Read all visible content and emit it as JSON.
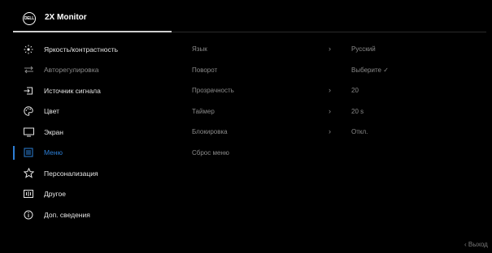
{
  "header": {
    "logo_text": "DELL",
    "title": "2X Monitor"
  },
  "menu": {
    "items": [
      {
        "label": "Яркость/контрастность",
        "icon": "brightness-icon"
      },
      {
        "label": "Авторегулировка",
        "icon": "auto-adjust-icon"
      },
      {
        "label": "Источник сигнала",
        "icon": "input-source-icon"
      },
      {
        "label": "Цвет",
        "icon": "color-palette-icon"
      },
      {
        "label": "Экран",
        "icon": "display-icon"
      },
      {
        "label": "Меню",
        "icon": "menu-icon"
      },
      {
        "label": "Персонализация",
        "icon": "star-icon"
      },
      {
        "label": "Другое",
        "icon": "other-icon"
      },
      {
        "label": "Доп. сведения",
        "icon": "info-icon"
      }
    ],
    "active_index": 5,
    "active_color": "#2d7fd6"
  },
  "submenu": {
    "rows": [
      {
        "name": "Язык",
        "arrow": "›",
        "value": "Русский"
      },
      {
        "name": "Поворот",
        "arrow": "",
        "value": "Выберите ✓"
      },
      {
        "name": "Прозрачность",
        "arrow": "›",
        "value": "20"
      },
      {
        "name": "Таймер",
        "arrow": "›",
        "value": "20 s"
      },
      {
        "name": "Блокировка",
        "arrow": "›",
        "value": "Откл."
      },
      {
        "name": "Сброс меню",
        "arrow": "",
        "value": ""
      }
    ]
  },
  "footer": {
    "exit_label": "‹ Выход"
  }
}
